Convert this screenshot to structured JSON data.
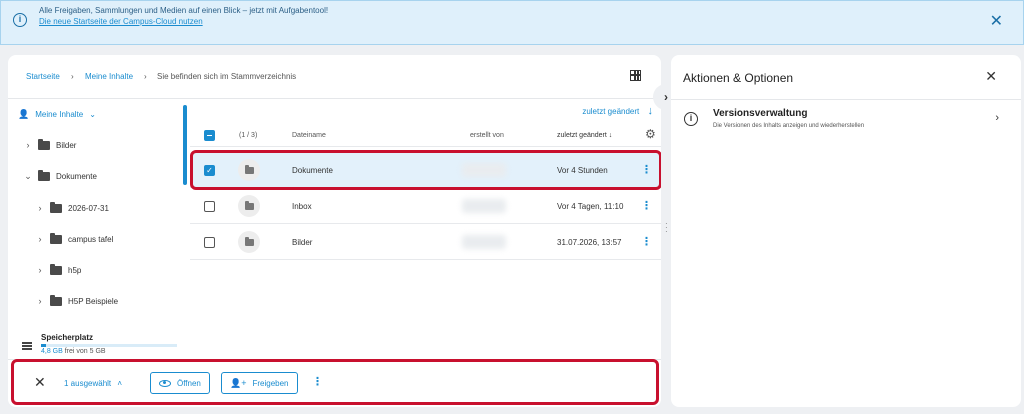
{
  "banner": {
    "text": "Alle Freigaben, Sammlungen und Medien auf einen Blick – jetzt mit Aufgabentool!",
    "link": "Die neue Startseite der Campus-Cloud nutzen",
    "close_icon": "close-icon"
  },
  "breadcrumb": {
    "items": [
      "Startseite",
      "Meine Inhalte"
    ],
    "current": "Sie befinden sich im Stammverzeichnis"
  },
  "sidebar": {
    "root": "Meine Inhalte",
    "items": [
      {
        "label": "Bilder"
      },
      {
        "label": "Dokumente"
      },
      {
        "label": "2026-07-31"
      },
      {
        "label": "campus tafel"
      },
      {
        "label": "h5p"
      },
      {
        "label": "H5P Beispiele"
      }
    ],
    "storage": {
      "label": "Speicherplatz",
      "free": "4,8 GB",
      "suffix": " frei von 5 GB",
      "used_fraction": 0.04
    }
  },
  "table": {
    "sort_label": "zuletzt geändert",
    "headers": {
      "count": "(1 / 3)",
      "name": "Dateiname",
      "created_by": "erstellt von",
      "modified": "zuletzt geändert"
    },
    "rows": [
      {
        "name": "Dokumente",
        "modified": "Vor 4 Stunden",
        "selected": true
      },
      {
        "name": "Inbox",
        "modified": "Vor 4 Tagen, 11:10",
        "selected": false
      },
      {
        "name": "Bilder",
        "modified": "31.07.2026, 13:57",
        "selected": false
      }
    ]
  },
  "bottom_bar": {
    "selected": "1 ausgewählt",
    "open": "Öffnen",
    "share": "Freigeben"
  },
  "right_panel": {
    "title": "Aktionen & Optionen",
    "version_title": "Versionsverwaltung",
    "version_sub": "Die Versionen des Inhalts anzeigen und wiederherstellen"
  },
  "colors": {
    "accent": "#1a8ccf",
    "highlight": "#c8102e",
    "banner_bg": "#dff0fb"
  }
}
